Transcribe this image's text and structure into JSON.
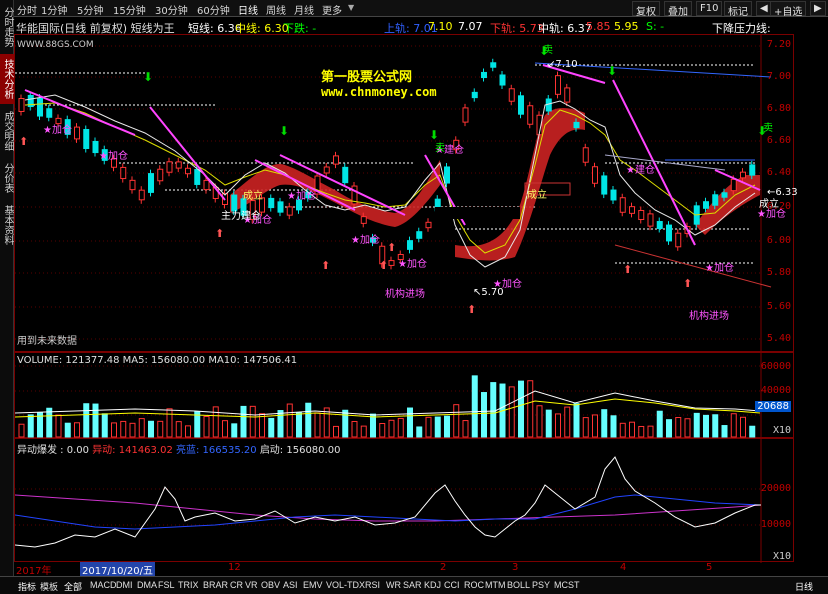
{
  "left_tabs": [
    "分时走势",
    "技术分析",
    "成交明细",
    "分价表",
    "基本资料"
  ],
  "timeframes": [
    "分时",
    "1分钟",
    "5分钟",
    "15分钟",
    "30分钟",
    "60分钟",
    "日线",
    "周线",
    "月线",
    "更多"
  ],
  "toolbar": {
    "restore": "复权",
    "overlay": "叠加",
    "f10": "F10",
    "mark": "标记",
    "add_watch": "+自选"
  },
  "title": {
    "name": "华能国际(日线 前复权) 短线为王",
    "short_label": "短线: 6.36",
    "mid_label": "中线: 6.30",
    "down_label": "下跌: -",
    "upper": "上轨: 7.01",
    "v710": "7.10",
    "v707": "7.07",
    "lower": "下轨: 5.73",
    "midtrack": "中轨: 6.37",
    "v585": "5.85",
    "v595": "5.95",
    "s_label": "S: -",
    "pressure": "下降压力线:"
  },
  "watermark": {
    "site": "第一股票公式网",
    "url": "www.chnmoney.com",
    "corner": "WWW.88GS.COM"
  },
  "annotations": {
    "add": "加仓",
    "build": "建仓",
    "main_build": "主力建仓",
    "done": "成立",
    "sell": "卖",
    "inst": "机构进场",
    "future_data": "用到未来数据",
    "p710": "7.10",
    "p570": "5.70",
    "p633": "6.33"
  },
  "main_axis": [
    "7.20",
    "7.00",
    "6.80",
    "6.60",
    "6.40",
    "6.20",
    "6.00",
    "5.80",
    "5.60",
    "5.40"
  ],
  "volume": {
    "header": "VOLUME: 121377.48  MA5: 156080.00  MA10: 147506.41",
    "axis": [
      "60000",
      "40000",
      "20000"
    ],
    "badge": "20688",
    "unit": "X10"
  },
  "abnormal": {
    "header_prefix": "异动爆发 : 0.00",
    "a1": "异动: 141463.02",
    "a2": "亮蓝: 166535.20",
    "a3": "启动: 156080.00",
    "axis": [
      "20000",
      "10000"
    ],
    "unit": "X10"
  },
  "x_axis": {
    "year": "2017年",
    "cursor_date": "2017/10/20/五",
    "m12": "12",
    "m2": "2",
    "m3": "3",
    "m4": "4",
    "m5": "5"
  },
  "bottom_tabs": [
    "指标",
    "模板",
    "全部",
    "MACD",
    "DMI",
    "DMA",
    "FSL",
    "TRIX",
    "BRAR",
    "CR",
    "VR",
    "OBV",
    "ASI",
    "EMV",
    "VOL-TDX",
    "RSI",
    "WR",
    "SAR",
    "KDJ",
    "CCI",
    "ROC",
    "MTM",
    "BOLL",
    "PSY",
    "MCST"
  ],
  "period_label": "日线",
  "colors": {
    "up": "#ff3333",
    "down": "#00e5e5",
    "accent": "#ffff00",
    "magenta": "#ff44ff",
    "axis": "#c00000"
  }
}
